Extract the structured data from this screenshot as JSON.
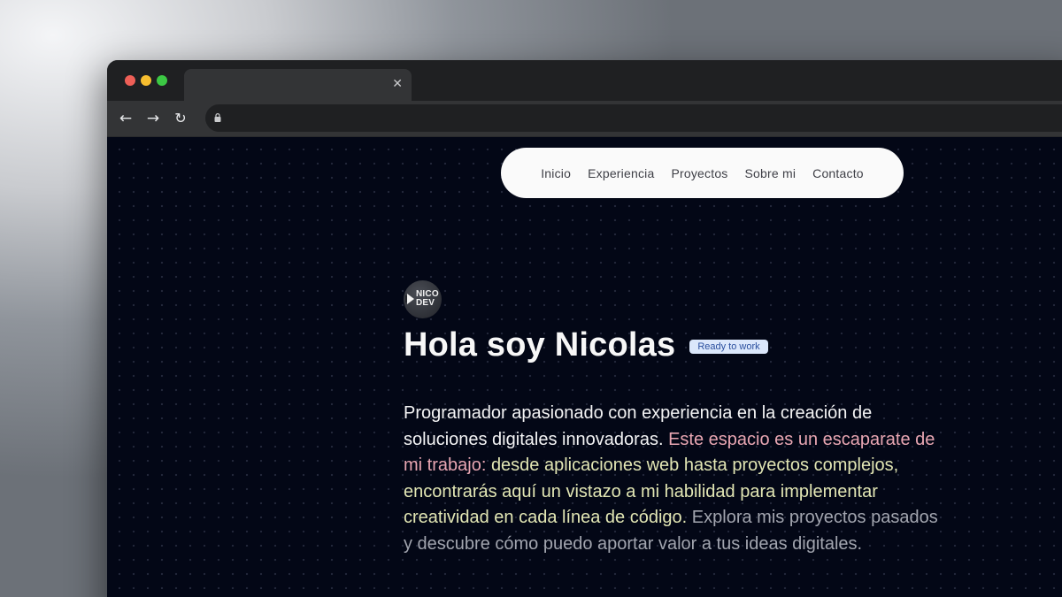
{
  "browser": {
    "tab": {
      "title": "",
      "close_icon": "close-icon"
    },
    "toolbar": {
      "back_icon": "arrow-left-icon",
      "forward_icon": "arrow-right-icon",
      "reload_icon": "reload-icon",
      "url": "",
      "lock_icon": "lock-icon"
    }
  },
  "navbar": {
    "items": [
      {
        "label": "Inicio"
      },
      {
        "label": "Experiencia"
      },
      {
        "label": "Proyectos"
      },
      {
        "label": "Sobre mi"
      },
      {
        "label": "Contacto"
      }
    ]
  },
  "hero": {
    "logo": {
      "line1": "NICO",
      "line2": "DEV"
    },
    "title": "Hola soy Nicolas",
    "badge": "Ready to work",
    "bio": {
      "part1": "Programador apasionado con experiencia en la creación de soluciones digitales innovadoras.",
      "part2": "Este espacio es un escaparate de mi trabajo:",
      "part3": "desde aplicaciones web hasta proyectos complejos, encontrarás aquí un vistazo a mi habilidad para implementar creatividad en cada línea de código.",
      "part4": "Explora mis proyectos pasados y descubre cómo puedo aportar valor a tus ideas digitales."
    }
  },
  "colors": {
    "page_background": "#030716",
    "navbar_background": "#fafafa",
    "badge_background": "#dbe7fb",
    "badge_text": "#2b4f9e",
    "bio_highlight_pink": "#e8a6b2",
    "bio_highlight_yellow": "#e2e6b4",
    "bio_muted": "#a2a5af"
  }
}
